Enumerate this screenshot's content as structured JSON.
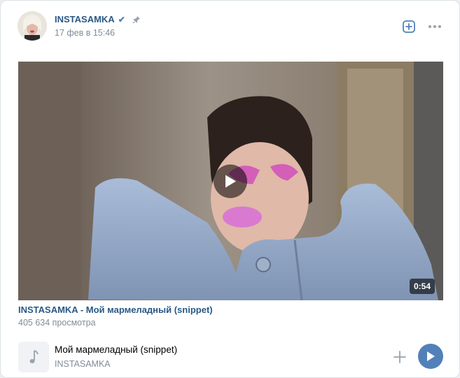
{
  "post": {
    "author": "INSTASAMKA",
    "date": "17 фев в 15:46",
    "avatar_icon": "user-avatar",
    "verified_icon": "checkmark-icon",
    "pin_icon": "pin-icon"
  },
  "header_actions": {
    "add_icon": "plus-square-icon",
    "more_icon": "more-dots-icon"
  },
  "video": {
    "duration": "0:54",
    "title": "INSTASAMKA - Мой мармеладный (snippet)",
    "views": "405 634 просмотра",
    "play_icon": "play-icon"
  },
  "audio": {
    "title": "Мой мармеладный (snippet)",
    "artist": "INSTASAMKA",
    "cover_icon": "music-note-icon",
    "add_icon": "plus-icon",
    "play_icon": "play-icon"
  },
  "colors": {
    "link": "#2a5885",
    "secondary": "#818c99",
    "accent": "#5181b8"
  }
}
